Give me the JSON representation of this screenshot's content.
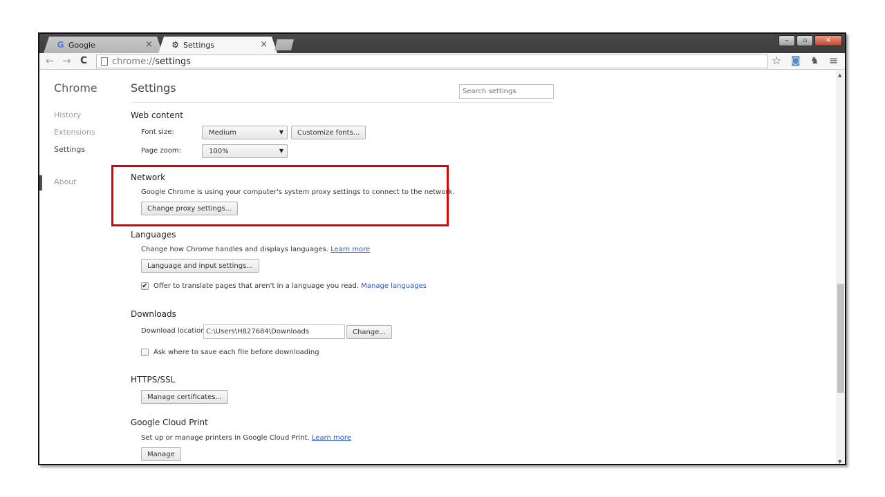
{
  "tabs": [
    {
      "label": "Google",
      "icon": "G",
      "close": "×"
    },
    {
      "label": "Settings",
      "icon": "⚙",
      "close": "×"
    }
  ],
  "window_controls": {
    "minimize": "–",
    "restore": "▫",
    "close": "✕"
  },
  "toolbar": {
    "back": "←",
    "forward": "→",
    "reload": "C",
    "url_scheme": "chrome://",
    "url_host": "settings",
    "star": "☆",
    "camera": "◙",
    "ghost": "♞",
    "menu": "≡"
  },
  "sidebar": {
    "title": "Chrome",
    "items": [
      {
        "label": "History"
      },
      {
        "label": "Extensions"
      },
      {
        "label": "Settings"
      },
      {
        "label": "About"
      }
    ]
  },
  "header": {
    "title": "Settings",
    "search_placeholder": "Search settings"
  },
  "web_content": {
    "title": "Web content",
    "font_size_label": "Font size:",
    "font_size_value": "Medium",
    "customize_fonts": "Customize fonts...",
    "page_zoom_label": "Page zoom:",
    "page_zoom_value": "100%"
  },
  "network": {
    "title": "Network",
    "description": "Google Chrome is using your computer's system proxy settings to connect to the network.",
    "change_proxy": "Change proxy settings..."
  },
  "languages": {
    "title": "Languages",
    "description": "Change how Chrome handles and displays languages.",
    "learn_more": "Learn more",
    "input_settings": "Language and input settings...",
    "translate_label": "Offer to translate pages that aren't in a language you read.",
    "manage_languages": "Manage languages",
    "translate_checked": "✔"
  },
  "downloads": {
    "title": "Downloads",
    "location_label": "Download location:",
    "location_value": "C:\\Users\\H827684\\Downloads",
    "change": "Change...",
    "ask_label": "Ask where to save each file before downloading"
  },
  "https": {
    "title": "HTTPS/SSL",
    "manage_certificates": "Manage certificates..."
  },
  "cloud_print": {
    "title": "Google Cloud Print",
    "description": "Set up or manage printers in Google Cloud Print.",
    "learn_more": "Learn more",
    "manage": "Manage"
  },
  "scrollbar": {
    "up": "▲",
    "down": "▼"
  },
  "colors": {
    "highlight": "#e00000",
    "link": "#2a56c6"
  }
}
